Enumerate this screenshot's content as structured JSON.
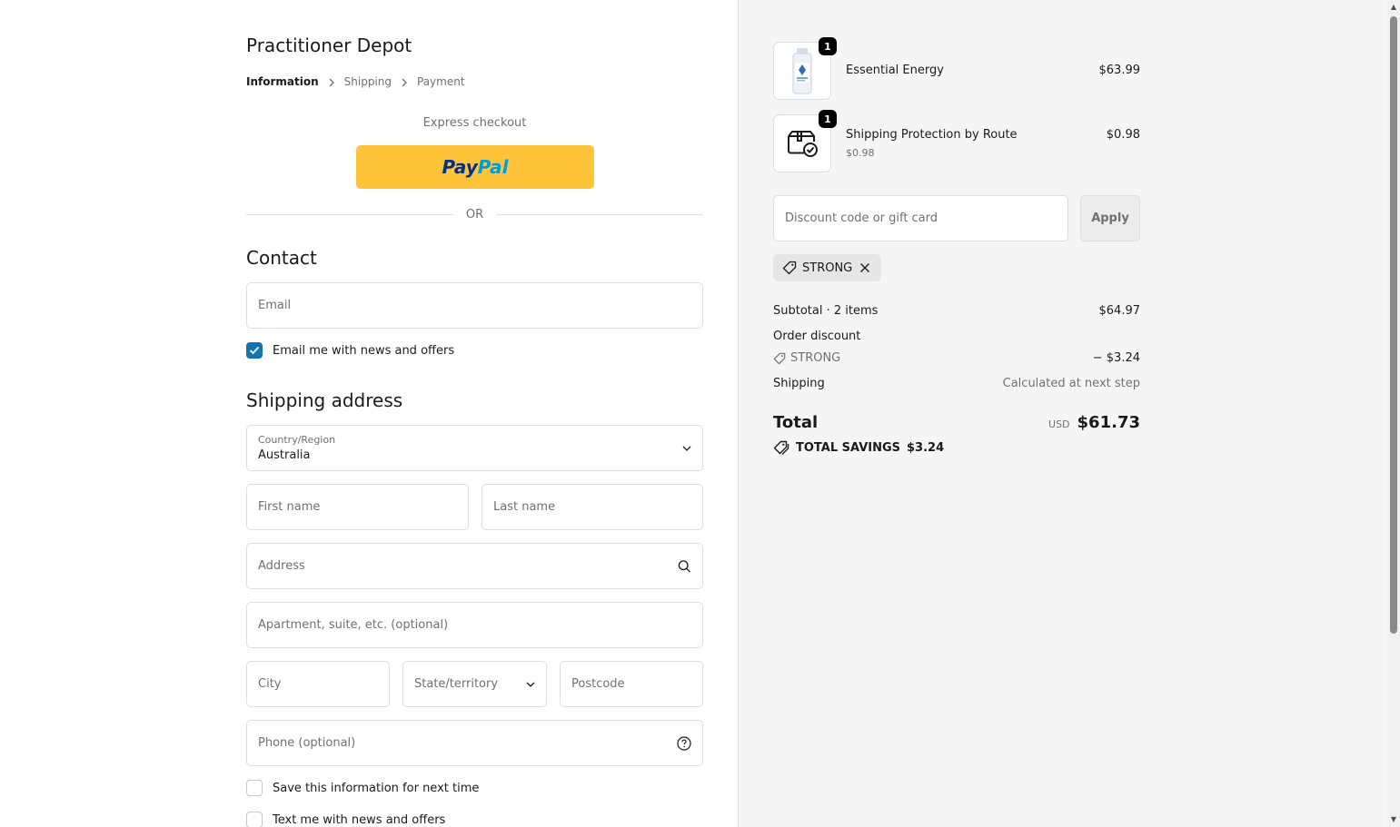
{
  "store_name": "Practitioner Depot",
  "breadcrumb": {
    "steps": [
      "Information",
      "Shipping",
      "Payment"
    ]
  },
  "express": {
    "label": "Express checkout",
    "paypal_pay": "Pay",
    "paypal_pal": "Pal",
    "or_label": "OR"
  },
  "contact": {
    "heading": "Contact",
    "email_placeholder": "Email",
    "news_label": "Email me with news and offers",
    "news_checked": true
  },
  "shipping": {
    "heading": "Shipping address",
    "country_label": "Country/Region",
    "country_value": "Australia",
    "first_name": "First name",
    "last_name": "Last name",
    "address": "Address",
    "apartment": "Apartment, suite, etc. (optional)",
    "city": "City",
    "state": "State/territory",
    "postcode": "Postcode",
    "phone": "Phone (optional)",
    "save_label": "Save this information for next time",
    "text_label": "Text me with news and offers"
  },
  "order": {
    "items": [
      {
        "name": "Essential Energy",
        "qty": "1",
        "price": "$63.99",
        "sub": ""
      },
      {
        "name": "Shipping Protection by Route",
        "qty": "1",
        "price": "$0.98",
        "sub": "$0.98"
      }
    ],
    "discount_placeholder": "Discount code or gift card",
    "apply_label": "Apply",
    "applied_code": "STRONG",
    "subtotal_label": "Subtotal · 2 items",
    "subtotal_value": "$64.97",
    "order_discount_label": "Order discount",
    "discount_code": "STRONG",
    "discount_value": "− $3.24",
    "shipping_label": "Shipping",
    "shipping_value": "Calculated at next step",
    "total_label": "Total",
    "currency": "USD",
    "total_value": "$61.73",
    "savings_label": "TOTAL SAVINGS",
    "savings_value": "$3.24"
  },
  "colors": {
    "accent": "#1773b0",
    "paypal_yellow": "#ffc439",
    "sidebar_bg": "#f5f5f5"
  }
}
